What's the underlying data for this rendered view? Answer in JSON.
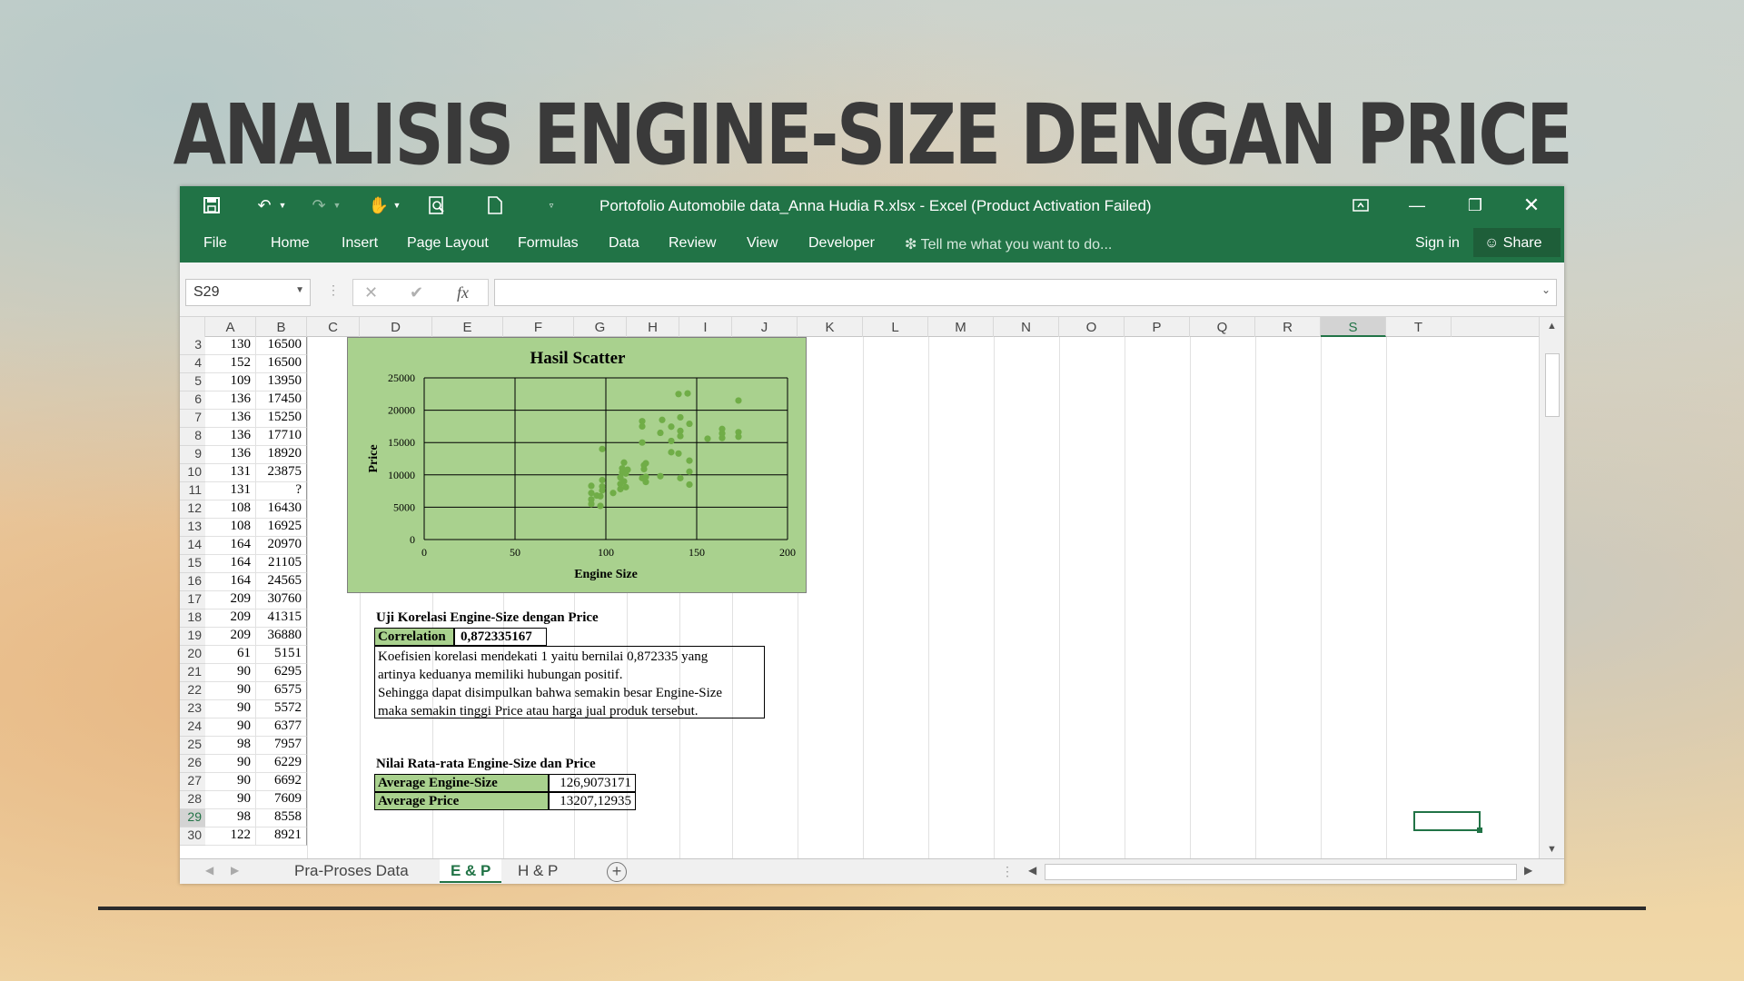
{
  "slide": {
    "title": "ANALISIS ENGINE-SIZE DENGAN PRICE"
  },
  "window": {
    "title": "Portofolio Automobile data_Anna Hudia R.xlsx - Excel (Product Activation Failed)",
    "icons": [
      "save-icon",
      "undo-icon",
      "redo-icon",
      "touch-mode-icon",
      "print-preview-icon",
      "new-file-icon",
      "customize-qat-icon",
      "ribbon-display-icon",
      "minimize-icon",
      "restore-icon",
      "close-icon"
    ]
  },
  "ribbon": {
    "tabs": [
      "File",
      "Home",
      "Insert",
      "Page Layout",
      "Formulas",
      "Data",
      "Review",
      "View",
      "Developer"
    ],
    "tell_me": "Tell me what you want to do...",
    "sign_in": "Sign in",
    "share": "Share"
  },
  "formula_bar": {
    "name_box": "S29",
    "fx": "fx",
    "formula": ""
  },
  "columns": [
    "A",
    "B",
    "C",
    "D",
    "E",
    "F",
    "G",
    "H",
    "I",
    "J",
    "K",
    "L",
    "M",
    "N",
    "O",
    "P",
    "Q",
    "R",
    "S",
    "T"
  ],
  "selected_column": "S",
  "rows": [
    {
      "n": "3",
      "a": "130",
      "b": "16500"
    },
    {
      "n": "4",
      "a": "152",
      "b": "16500"
    },
    {
      "n": "5",
      "a": "109",
      "b": "13950"
    },
    {
      "n": "6",
      "a": "136",
      "b": "17450"
    },
    {
      "n": "7",
      "a": "136",
      "b": "15250"
    },
    {
      "n": "8",
      "a": "136",
      "b": "17710"
    },
    {
      "n": "9",
      "a": "136",
      "b": "18920"
    },
    {
      "n": "10",
      "a": "131",
      "b": "23875"
    },
    {
      "n": "11",
      "a": "131",
      "b": "?"
    },
    {
      "n": "12",
      "a": "108",
      "b": "16430"
    },
    {
      "n": "13",
      "a": "108",
      "b": "16925"
    },
    {
      "n": "14",
      "a": "164",
      "b": "20970"
    },
    {
      "n": "15",
      "a": "164",
      "b": "21105"
    },
    {
      "n": "16",
      "a": "164",
      "b": "24565"
    },
    {
      "n": "17",
      "a": "209",
      "b": "30760"
    },
    {
      "n": "18",
      "a": "209",
      "b": "41315"
    },
    {
      "n": "19",
      "a": "209",
      "b": "36880"
    },
    {
      "n": "20",
      "a": "61",
      "b": "5151"
    },
    {
      "n": "21",
      "a": "90",
      "b": "6295"
    },
    {
      "n": "22",
      "a": "90",
      "b": "6575"
    },
    {
      "n": "23",
      "a": "90",
      "b": "5572"
    },
    {
      "n": "24",
      "a": "90",
      "b": "6377"
    },
    {
      "n": "25",
      "a": "98",
      "b": "7957"
    },
    {
      "n": "26",
      "a": "90",
      "b": "6229"
    },
    {
      "n": "27",
      "a": "90",
      "b": "6692"
    },
    {
      "n": "28",
      "a": "90",
      "b": "7609"
    },
    {
      "n": "29",
      "a": "98",
      "b": "8558"
    },
    {
      "n": "30",
      "a": "122",
      "b": "8921"
    }
  ],
  "selected_row": "29",
  "chart_data": {
    "type": "scatter",
    "title": "Hasil Scatter",
    "xlabel": "Engine Size",
    "ylabel": "Price",
    "xlim": [
      0,
      200
    ],
    "ylim": [
      0,
      25000
    ],
    "xticks": [
      "0",
      "50",
      "100",
      "150",
      "200"
    ],
    "yticks": [
      "0",
      "5000",
      "10000",
      "15000",
      "20000",
      "25000"
    ],
    "grid": true,
    "color": "#70ad47",
    "points": [
      [
        92,
        5500
      ],
      [
        92,
        6200
      ],
      [
        92,
        7200
      ],
      [
        92,
        8300
      ],
      [
        95,
        6800
      ],
      [
        97,
        5200
      ],
      [
        97,
        6700
      ],
      [
        98,
        7600
      ],
      [
        98,
        8200
      ],
      [
        98,
        9200
      ],
      [
        98,
        14000
      ],
      [
        104,
        7200
      ],
      [
        108,
        7800
      ],
      [
        108,
        8600
      ],
      [
        108,
        9600
      ],
      [
        109,
        10400
      ],
      [
        109,
        11000
      ],
      [
        110,
        9000
      ],
      [
        110,
        11900
      ],
      [
        111,
        10200
      ],
      [
        111,
        8100
      ],
      [
        112,
        10800
      ],
      [
        120,
        9500
      ],
      [
        121,
        10900
      ],
      [
        121,
        11500
      ],
      [
        122,
        8900
      ],
      [
        122,
        9700
      ],
      [
        122,
        11800
      ],
      [
        120,
        15000
      ],
      [
        120,
        17500
      ],
      [
        120,
        18300
      ],
      [
        130,
        9800
      ],
      [
        130,
        16500
      ],
      [
        131,
        18500
      ],
      [
        136,
        13500
      ],
      [
        136,
        15250
      ],
      [
        136,
        17450
      ],
      [
        140,
        13300
      ],
      [
        140,
        22500
      ],
      [
        141,
        16000
      ],
      [
        141,
        16800
      ],
      [
        141,
        18900
      ],
      [
        141,
        9500
      ],
      [
        145,
        22600
      ],
      [
        146,
        17900
      ],
      [
        146,
        12200
      ],
      [
        146,
        8500
      ],
      [
        146,
        10500
      ],
      [
        156,
        15600
      ],
      [
        164,
        15700
      ],
      [
        164,
        16400
      ],
      [
        164,
        17100
      ],
      [
        173,
        21500
      ],
      [
        173,
        16600
      ],
      [
        173,
        15900
      ]
    ]
  },
  "correlation": {
    "heading": "Uji Korelasi Engine-Size dengan Price",
    "label": "Correlation",
    "value": "0,872335167",
    "notes": [
      "Koefisien korelasi mendekati 1 yaitu bernilai 0,872335 yang",
      "artinya keduanya memiliki hubungan positif.",
      "Sehingga dapat disimpulkan bahwa semakin besar Engine-Size",
      "maka semakin tinggi Price atau harga jual produk tersebut."
    ]
  },
  "averages": {
    "heading": "Nilai Rata-rata Engine-Size dan Price",
    "engine_label": "Average Engine-Size",
    "engine_value": "126,9073171",
    "price_label": "Average Price",
    "price_value": "13207,12935"
  },
  "sheets": [
    "Pra-Proses Data",
    "E & P",
    "H & P"
  ],
  "active_sheet": "E & P"
}
